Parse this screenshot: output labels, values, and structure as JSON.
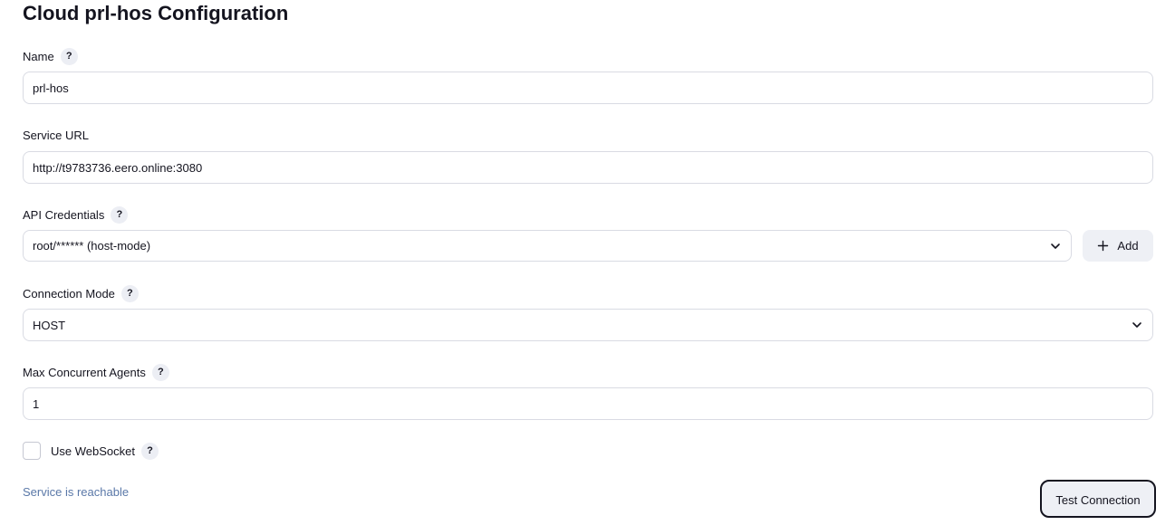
{
  "page": {
    "title": "Cloud prl-hos Configuration"
  },
  "fields": {
    "name": {
      "label": "Name",
      "value": "prl-hos"
    },
    "service_url": {
      "label": "Service URL",
      "value": "http://t9783736.eero.online:3080"
    },
    "api_credentials": {
      "label": "API Credentials",
      "value": "root/****** (host-mode)",
      "add_label": "Add"
    },
    "connection_mode": {
      "label": "Connection Mode",
      "value": "HOST"
    },
    "max_concurrent_agents": {
      "label": "Max Concurrent Agents",
      "value": "1"
    },
    "use_websocket": {
      "label": "Use WebSocket",
      "checked": false
    }
  },
  "help_glyph": "?",
  "status": {
    "text": "Service is reachable",
    "color": "#5a78a8"
  },
  "actions": {
    "test_connection_label": "Test Connection"
  },
  "icons": {
    "help": "help-icon",
    "chevron": "chevron-down-icon",
    "plus": "plus-icon"
  }
}
